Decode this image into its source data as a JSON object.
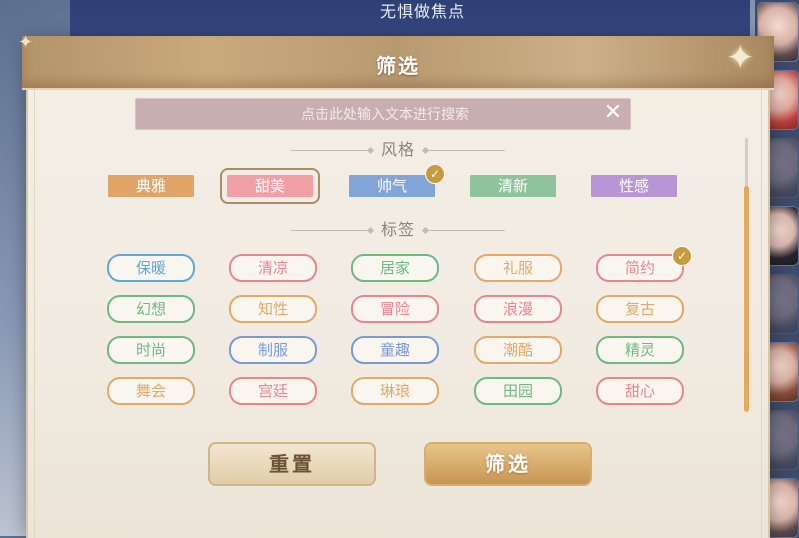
{
  "background": {
    "top_text": "无惧做焦点"
  },
  "dialog": {
    "title": "筛选"
  },
  "search": {
    "placeholder": "点击此处输入文本进行搜索"
  },
  "style_section": {
    "label": "风格",
    "options": [
      {
        "label": "典雅",
        "color": "#e0a566",
        "selected": false
      },
      {
        "label": "甜美",
        "color": "#f0a0a6",
        "selected": false,
        "focused": true
      },
      {
        "label": "帅气",
        "color": "#83a4d6",
        "selected": true
      },
      {
        "label": "清新",
        "color": "#8ec39b",
        "selected": false
      },
      {
        "label": "性感",
        "color": "#b896d6",
        "selected": false
      }
    ]
  },
  "tag_section": {
    "label": "标签",
    "tags": [
      {
        "label": "保暖",
        "color": "#5fa8d8",
        "selected": false
      },
      {
        "label": "清凉",
        "color": "#e8868e",
        "selected": false
      },
      {
        "label": "居家",
        "color": "#6fb884",
        "selected": false
      },
      {
        "label": "礼服",
        "color": "#e0aa6a",
        "selected": false
      },
      {
        "label": "简约",
        "color": "#e8868e",
        "selected": true
      },
      {
        "label": "幻想",
        "color": "#6fb884",
        "selected": false
      },
      {
        "label": "知性",
        "color": "#e0aa6a",
        "selected": false
      },
      {
        "label": "冒险",
        "color": "#e8868e",
        "selected": false
      },
      {
        "label": "浪漫",
        "color": "#e8868e",
        "selected": false
      },
      {
        "label": "复古",
        "color": "#e0aa6a",
        "selected": false
      },
      {
        "label": "时尚",
        "color": "#6fb884",
        "selected": false
      },
      {
        "label": "制服",
        "color": "#7a9ad6",
        "selected": false
      },
      {
        "label": "童趣",
        "color": "#7a9ad6",
        "selected": false
      },
      {
        "label": "潮酷",
        "color": "#e0aa6a",
        "selected": false
      },
      {
        "label": "精灵",
        "color": "#6fb884",
        "selected": false
      },
      {
        "label": "舞会",
        "color": "#e0aa6a",
        "selected": false
      },
      {
        "label": "宫廷",
        "color": "#e8868e",
        "selected": false
      },
      {
        "label": "琳琅",
        "color": "#e0aa6a",
        "selected": false
      },
      {
        "label": "田园",
        "color": "#6fb884",
        "selected": false
      },
      {
        "label": "甜心",
        "color": "#e8868e",
        "selected": false
      }
    ]
  },
  "buttons": {
    "reset": "重置",
    "apply": "筛选"
  }
}
